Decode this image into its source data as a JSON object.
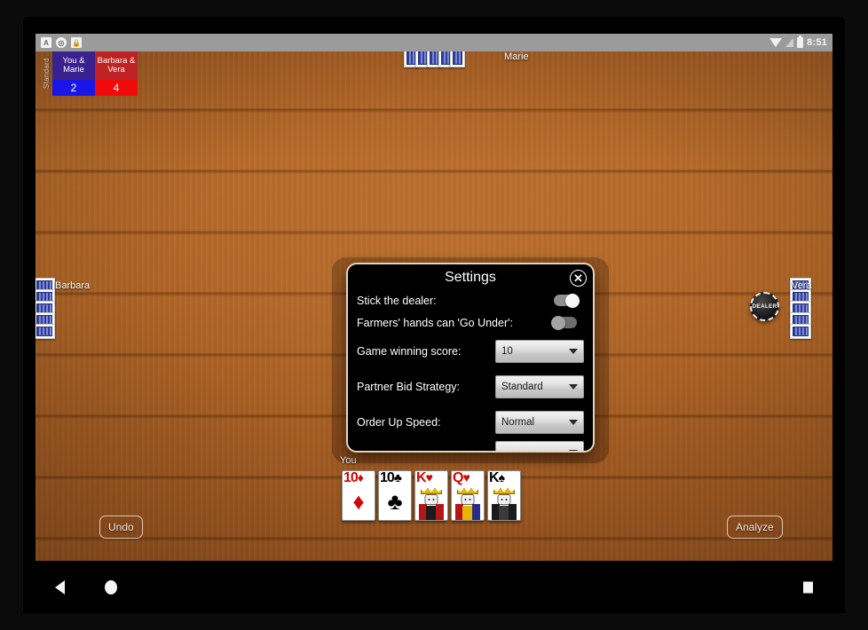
{
  "status_bar": {
    "notification_icons": [
      "app-icon",
      "sync-circle-icon",
      "lock-icon"
    ],
    "wifi_icon": "wifi-icon",
    "signal_icon": "signal-icon",
    "battery_icon": "battery-icon",
    "time": "8:51"
  },
  "scoreboard": {
    "mode_label": "Standard",
    "teams": [
      {
        "name": "You & Marie",
        "score": "2",
        "color": "#1b16e8"
      },
      {
        "name": "Barbara & Vera",
        "score": "4",
        "color": "#f10a0a"
      }
    ]
  },
  "players": {
    "top": {
      "name": "Marie"
    },
    "left": {
      "name": "Barbara"
    },
    "right": {
      "name": "Vera",
      "dealer_badge": "DEALER"
    },
    "bottom": {
      "name": "You",
      "hand": [
        {
          "rank": "10",
          "suit": "♦",
          "color": "red",
          "art": "pip"
        },
        {
          "rank": "10",
          "suit": "♣",
          "color": "black",
          "art": "pip"
        },
        {
          "rank": "K",
          "suit": "♥",
          "color": "red",
          "art": "king"
        },
        {
          "rank": "Q",
          "suit": "♥",
          "color": "red",
          "art": "queen"
        },
        {
          "rank": "K",
          "suit": "♠",
          "color": "black",
          "art": "king-spade"
        }
      ]
    }
  },
  "table_buttons": {
    "undo_label": "Undo",
    "analyze_label": "Analyze"
  },
  "settings_dialog": {
    "title": "Settings",
    "close_label": "✕",
    "toggles": [
      {
        "label": "Stick the dealer:",
        "state": "on"
      },
      {
        "label": "Farmers' hands can 'Go Under':",
        "state": "off"
      }
    ],
    "selects": [
      {
        "label": "Game winning score:",
        "value": "10"
      },
      {
        "label": "Partner Bid Strategy:",
        "value": "Standard"
      },
      {
        "label": "Order Up Speed:",
        "value": "Normal"
      }
    ],
    "clipped_row": {
      "label": "",
      "value": ""
    }
  },
  "nav_bar": {
    "back": "back-icon",
    "home": "home-icon",
    "recent": "recent-apps-icon"
  }
}
